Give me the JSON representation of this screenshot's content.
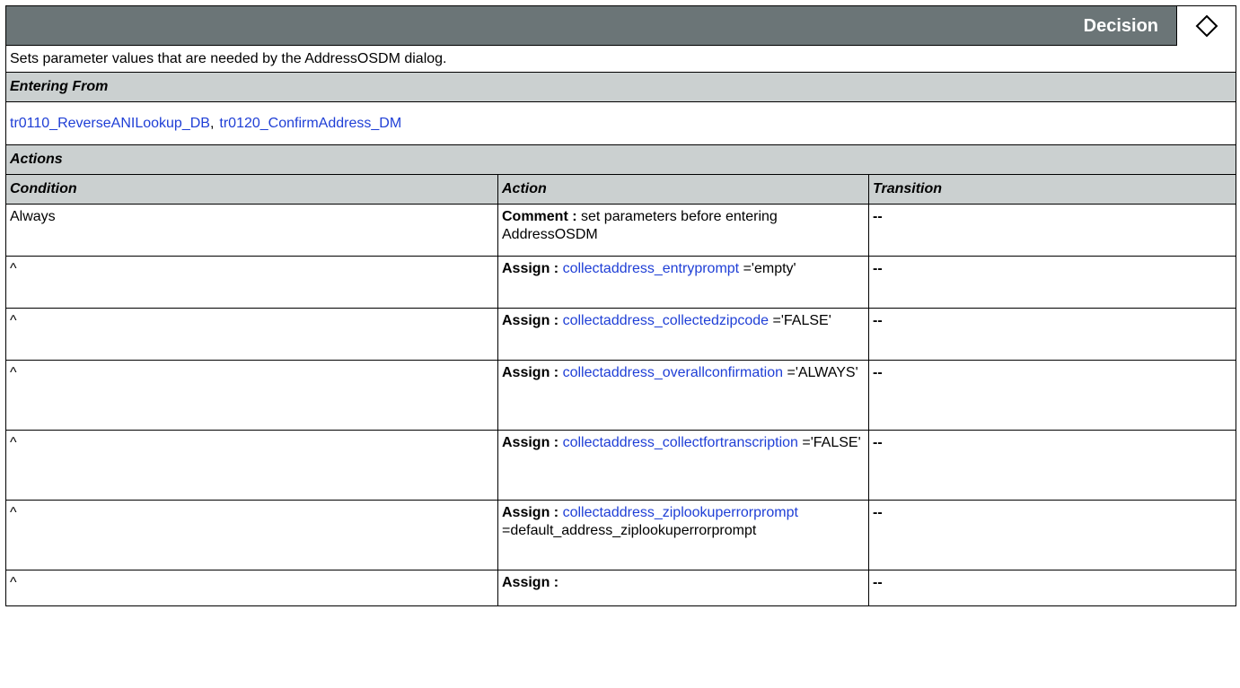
{
  "header": {
    "type_label": "Decision",
    "icon": "diamond-icon"
  },
  "description": "Sets parameter values that are needed by the AddressOSDM dialog.",
  "entering_from": {
    "heading": "Entering From",
    "links": [
      "tr0110_ReverseANILookup_DB",
      "tr0120_ConfirmAddress_DM"
    ],
    "separator": ","
  },
  "actions": {
    "heading": "Actions",
    "columns": [
      "Condition",
      "Action",
      "Transition"
    ],
    "rows": [
      {
        "condition": "Always",
        "kind": "Comment :",
        "text_before": " set parameters before entering AddressOSDM",
        "link": "",
        "text_after": "",
        "transition": "--"
      },
      {
        "condition": "^",
        "kind": "Assign :",
        "text_before": " ",
        "link": "collectaddress_entryprompt",
        "text_after": " ='empty'",
        "transition": "--"
      },
      {
        "condition": "^",
        "kind": "Assign :",
        "text_before": " ",
        "link": "collectaddress_collectedzipcode",
        "text_after": " ='FALSE'",
        "transition": "--"
      },
      {
        "condition": "^",
        "kind": "Assign :",
        "text_before": " ",
        "link": "collectaddress_overallconfirmation",
        "text_after": " ='ALWAYS'",
        "transition": "--"
      },
      {
        "condition": "^",
        "kind": "Assign :",
        "text_before": " ",
        "link": "collectaddress_collectfortranscription",
        "text_after": " ='FALSE'",
        "transition": "--"
      },
      {
        "condition": "^",
        "kind": "Assign :",
        "text_before": " ",
        "link": "collectaddress_ziplookuperrorprompt",
        "text_after": " =default_address_ziplookuperrorprompt",
        "transition": "--"
      },
      {
        "condition": "^",
        "kind": "Assign :",
        "text_before": "",
        "link": "",
        "text_after": "",
        "transition": "--"
      }
    ]
  },
  "colors": {
    "header_bg": "#6b7577",
    "section_bg": "#cbd0d0",
    "link": "#1f3fd6"
  }
}
